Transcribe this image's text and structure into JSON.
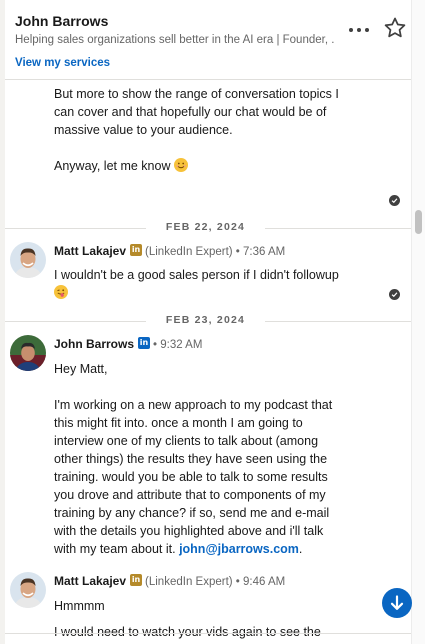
{
  "header": {
    "name": "John Barrows",
    "headline": "Helping sales organizations sell better in the AI era | Founder, .",
    "services_link": "View my services"
  },
  "messages": {
    "m0_lines": [
      "But more to show the range of conversation topics I",
      "can cover and that hopefully our chat would be of",
      "massive value to your audience.",
      "",
      "Anyway, let me know"
    ],
    "date1": "FEB 22, 2024",
    "m1_sender": "Matt Lakajev",
    "m1_meta": "(LinkedIn Expert) • 7:36 AM",
    "m1_text": "I wouldn't be a good sales person if I didn't followup",
    "date2": "FEB 23, 2024",
    "m2_sender": "John Barrows",
    "m2_meta": "• 9:32 AM",
    "m2_greeting": "Hey Matt,",
    "m2_body_lines": [
      "I'm working on a new approach to my podcast that",
      "this might fit into.  once a month I am going to",
      "interview one of my clients to talk about (among",
      "other things) the results they have seen using the",
      "training.  would you be able to talk to some results",
      "you drove and attribute that to components of my",
      "training by any chance?  if so, send me and e-mail",
      "with the details you highlighted above and i'll talk"
    ],
    "m2_last_prefix": "with my team about it.",
    "m2_email": "john@jbarrows.com",
    "m2_last_suffix": ".",
    "m3_sender": "Matt Lakajev",
    "m3_meta": "(LinkedIn Expert) • 9:46 AM",
    "m3_text": "Hmmmm",
    "m3_cut": "I would need to watch your vids again to see the"
  },
  "icons": {
    "more": "more-horizontal-icon",
    "star": "star-outline-icon",
    "check": "read-receipt-check-icon",
    "linkedin": "linkedin-badge-icon",
    "scroll_down": "arrow-down-icon"
  },
  "colors": {
    "accent": "#0a66c2",
    "premium": "#b58a2a",
    "muted": "#666666"
  }
}
